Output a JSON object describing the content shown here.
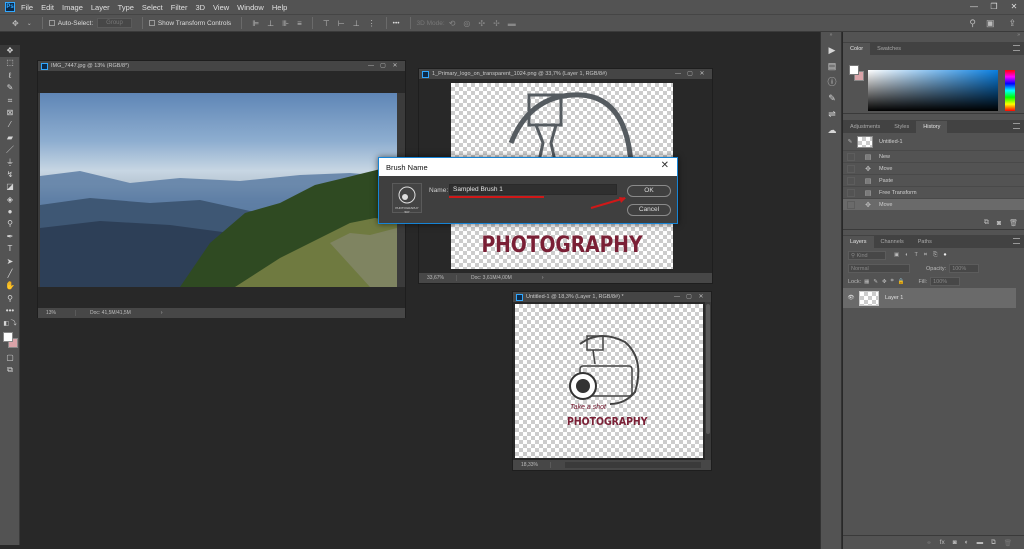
{
  "app": {
    "logo": "Ps"
  },
  "menu": [
    "File",
    "Edit",
    "Image",
    "Layer",
    "Type",
    "Select",
    "Filter",
    "3D",
    "View",
    "Window",
    "Help"
  ],
  "window_controls": {
    "minimize": "—",
    "restore": "❐",
    "close": "✕"
  },
  "options_bar": {
    "auto_select_label": "Auto-Select:",
    "group_value": "Group",
    "show_transform_label": "Show Transform Controls",
    "more_label": "•••",
    "mode_3d_label": "3D Mode:"
  },
  "documents": [
    {
      "title": "IMG_7447.jpg @ 13% (RGB/8*)",
      "zoom": "13%",
      "doc_info": "Doc: 41,5M/41,5M"
    },
    {
      "title": "1_Primary_logo_on_transparent_1024.png @ 33,7% (Layer 1, RGB/8#)",
      "zoom": "33,67%",
      "doc_info": "Doc: 3,61M/4,00M"
    },
    {
      "title": "Untitled-1 @ 18,3% (Layer 1, RGB/8#) *",
      "zoom": "18,33%",
      "doc_info": ""
    }
  ],
  "logo_art": {
    "tagline": "Take a shot",
    "wordmark": "PHOTOGRAPHY",
    "wordmark_color": "#7a1f35"
  },
  "dialog": {
    "title": "Brush Name",
    "name_label": "Name:",
    "name_value": "Sampled Brush 1",
    "thumb_caption": "PHOTOGRAPHY",
    "thumb_size": "507",
    "ok_label": "OK",
    "cancel_label": "Cancel",
    "annotation_color": "#d01818"
  },
  "color_panel": {
    "tabs": [
      "Color",
      "Swatches"
    ],
    "active_tab": "Color",
    "foreground": "#ffffff",
    "background": "#d9a3a8",
    "hue_base": "#0a7fe0"
  },
  "history_panel": {
    "tabs": [
      "Adjustments",
      "Styles",
      "History"
    ],
    "active_tab": "History",
    "snapshot": "Untitled-1",
    "items": [
      {
        "icon": "document-icon",
        "label": "New"
      },
      {
        "icon": "move-icon",
        "label": "Move"
      },
      {
        "icon": "document-icon",
        "label": "Paste"
      },
      {
        "icon": "document-icon",
        "label": "Free Transform"
      },
      {
        "icon": "move-icon",
        "label": "Move",
        "active": true
      }
    ]
  },
  "layers_panel": {
    "tabs": [
      "Layers",
      "Channels",
      "Paths"
    ],
    "active_tab": "Layers",
    "filter_placeholder": "Kind",
    "blend_mode": "Normal",
    "opacity_label": "Opacity:",
    "opacity_value": "100%",
    "lock_label": "Lock:",
    "fill_label": "Fill:",
    "fill_value": "100%",
    "layers": [
      {
        "name": "Layer 1",
        "visible": true
      }
    ]
  }
}
